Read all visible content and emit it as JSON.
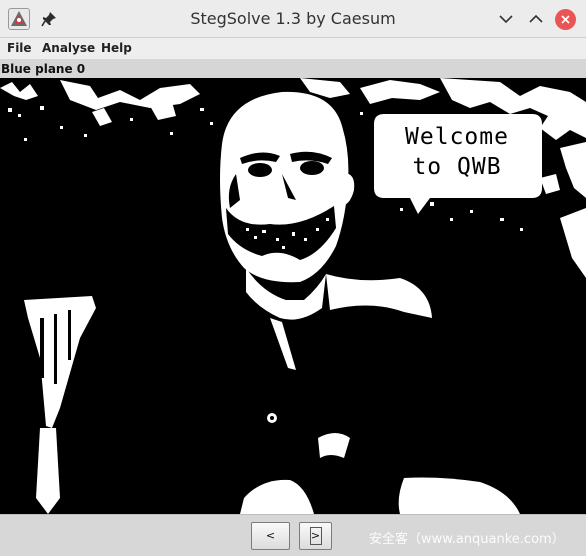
{
  "window": {
    "title": "StegSolve 1.3 by Caesum"
  },
  "menu": {
    "file": "File",
    "analyse": "Analyse",
    "help": "Help"
  },
  "view": {
    "plane_label": "Blue plane 0",
    "bubble_line1": "Welcome",
    "bubble_line2": "to QWB"
  },
  "nav": {
    "prev_label": "<",
    "next_label": ">"
  },
  "watermark": "安全客（www.anquanke.com）",
  "colors": {
    "close_button": "#e95454",
    "canvas_background": "#000000",
    "bitplane_foreground": "#ffffff"
  }
}
